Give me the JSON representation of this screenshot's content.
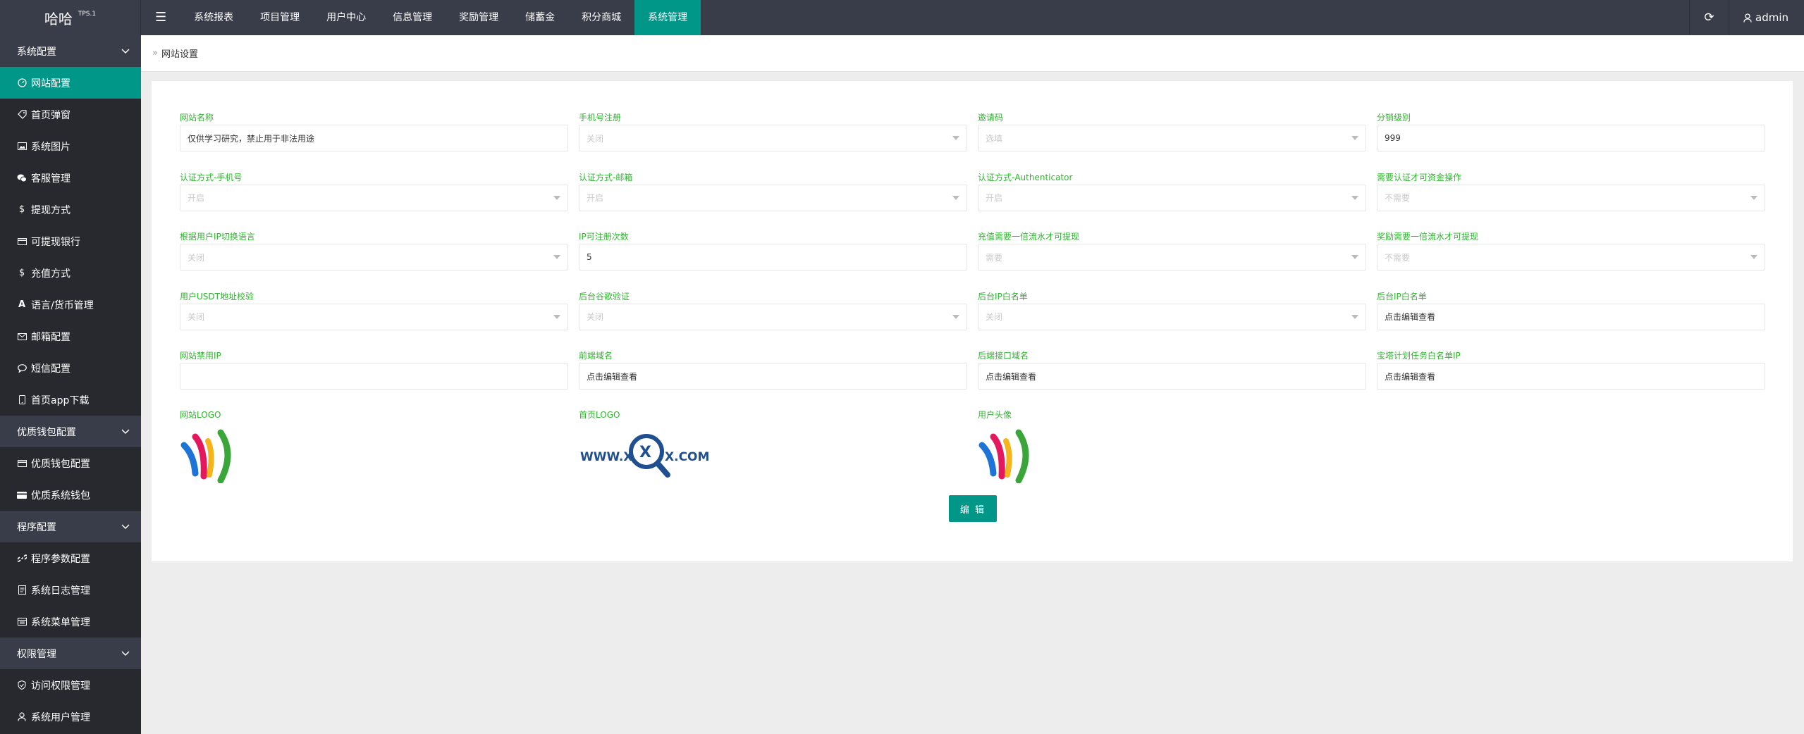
{
  "header": {
    "logo": "哈哈",
    "version": "TPS.1",
    "nav": [
      "系统报表",
      "项目管理",
      "用户中心",
      "信息管理",
      "奖励管理",
      "储蓄金",
      "积分商城",
      "系统管理"
    ],
    "user": "admin"
  },
  "sidebar": {
    "groups": [
      {
        "title": "系统配置",
        "items": [
          {
            "label": "网站配置",
            "icon": "dashboard-icon"
          },
          {
            "label": "首页弹窗",
            "icon": "tag-icon"
          },
          {
            "label": "系统图片",
            "icon": "picture-icon"
          },
          {
            "label": "客服管理",
            "icon": "chat-icon"
          },
          {
            "label": "提现方式",
            "icon": "dollar-icon"
          },
          {
            "label": "可提现银行",
            "icon": "card-icon"
          },
          {
            "label": "充值方式",
            "icon": "dollar-icon"
          },
          {
            "label": "语言/货币管理",
            "icon": "font-icon"
          },
          {
            "label": "邮箱配置",
            "icon": "mail-icon"
          },
          {
            "label": "短信配置",
            "icon": "speech-icon"
          },
          {
            "label": "首页app下载",
            "icon": "mobile-icon"
          }
        ]
      },
      {
        "title": "优质钱包配置",
        "items": [
          {
            "label": "优质钱包配置",
            "icon": "card-icon"
          },
          {
            "label": "优质系统钱包",
            "icon": "card-solid-icon"
          }
        ]
      },
      {
        "title": "程序配置",
        "items": [
          {
            "label": "程序参数配置",
            "icon": "link-icon"
          },
          {
            "label": "系统日志管理",
            "icon": "log-icon"
          },
          {
            "label": "系统菜单管理",
            "icon": "menu-icon"
          }
        ]
      },
      {
        "title": "权限管理",
        "items": [
          {
            "label": "访问权限管理",
            "icon": "shield-icon"
          },
          {
            "label": "系统用户管理",
            "icon": "user-icon"
          }
        ]
      }
    ]
  },
  "breadcrumb": "网站设置",
  "form": {
    "fields": [
      {
        "label": "网站名称",
        "type": "input",
        "value": "仅供学习研究，禁止用于非法用途"
      },
      {
        "label": "手机号注册",
        "type": "select",
        "value": "关闭"
      },
      {
        "label": "邀请码",
        "type": "select",
        "value": "选填"
      },
      {
        "label": "分销级别",
        "type": "input",
        "value": "999"
      },
      {
        "label": "认证方式-手机号",
        "type": "select",
        "value": "开启"
      },
      {
        "label": "认证方式-邮箱",
        "type": "select",
        "value": "开启"
      },
      {
        "label": "认证方式-Authenticator",
        "type": "select",
        "value": "开启"
      },
      {
        "label": "需要认证才可资金操作",
        "type": "select",
        "value": "不需要"
      },
      {
        "label": "根据用户IP切换语言",
        "type": "select",
        "value": "关闭"
      },
      {
        "label": "IP可注册次数",
        "type": "input",
        "value": "5"
      },
      {
        "label": "充值需要一倍流水才可提现",
        "type": "select",
        "value": "需要"
      },
      {
        "label": "奖励需要一倍流水才可提现",
        "type": "select",
        "value": "不需要"
      },
      {
        "label": "用户USDT地址校验",
        "type": "select",
        "value": "关闭"
      },
      {
        "label": "后台谷歌验证",
        "type": "select",
        "value": "关闭"
      },
      {
        "label": "后台IP白名单",
        "type": "select",
        "value": "关闭"
      },
      {
        "label": "后台IP白名单",
        "type": "input",
        "value": "点击编辑查看"
      },
      {
        "label": "网站禁用IP",
        "type": "input",
        "value": ""
      },
      {
        "label": "前端域名",
        "type": "input",
        "value": "点击编辑查看"
      },
      {
        "label": "后端接口域名",
        "type": "input",
        "value": "点击编辑查看"
      },
      {
        "label": "宝塔计划任务白名单IP",
        "type": "input",
        "value": "点击编辑查看"
      }
    ],
    "images": [
      {
        "label": "网站LOGO",
        "image": "wallet-logo"
      },
      {
        "label": "首页LOGO",
        "image": "xqx-logo",
        "text": "WWW.X X.COM"
      },
      {
        "label": "用户头像",
        "image": "wallet-logo"
      }
    ],
    "edit_button": "编 辑"
  },
  "colors": {
    "accent": "#009688",
    "label": "#2db52d",
    "topbar": "#393d49",
    "sidebar": "#28292e"
  }
}
